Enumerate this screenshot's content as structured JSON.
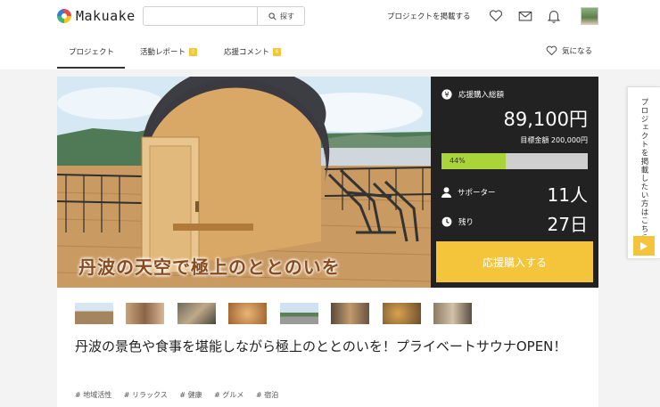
{
  "brand": {
    "name": "Makuake"
  },
  "search": {
    "placeholder": "",
    "button_label": "探す"
  },
  "header": {
    "post_project_label": "プロジェクトを掲載する"
  },
  "tabs": [
    {
      "label": "プロジェクト",
      "active": true
    },
    {
      "label": "活動レポート",
      "badge": "0"
    },
    {
      "label": "応援コメント",
      "badge": "6"
    }
  ],
  "favorite": {
    "label": "気になる"
  },
  "hero": {
    "caption": "丹波の天空で極上のととのいを"
  },
  "panel": {
    "total_label": "応援購入総額",
    "amount": "89,100円",
    "goal_text": "目標金額 200,000円",
    "progress_text": "44%",
    "progress_percent": 44,
    "supporters_label": "サポーター",
    "supporters_value": "11人",
    "remaining_label": "残り",
    "remaining_value": "27日",
    "back_button_label": "応援購入する"
  },
  "project": {
    "title": "丹波の景色や食事を堪能しながら極上のととのいを！プライベートサウナOPEN！",
    "tags": [
      "# 地域活性",
      "# リラックス",
      "# 健康",
      "# グルメ",
      "# 宿泊"
    ]
  },
  "side_tab": {
    "label": "プロジェクトを掲載したい方はこちら"
  },
  "colors": {
    "accent": "#f4c53a",
    "panel_bg": "#222222",
    "progress": "#a9d43a"
  }
}
